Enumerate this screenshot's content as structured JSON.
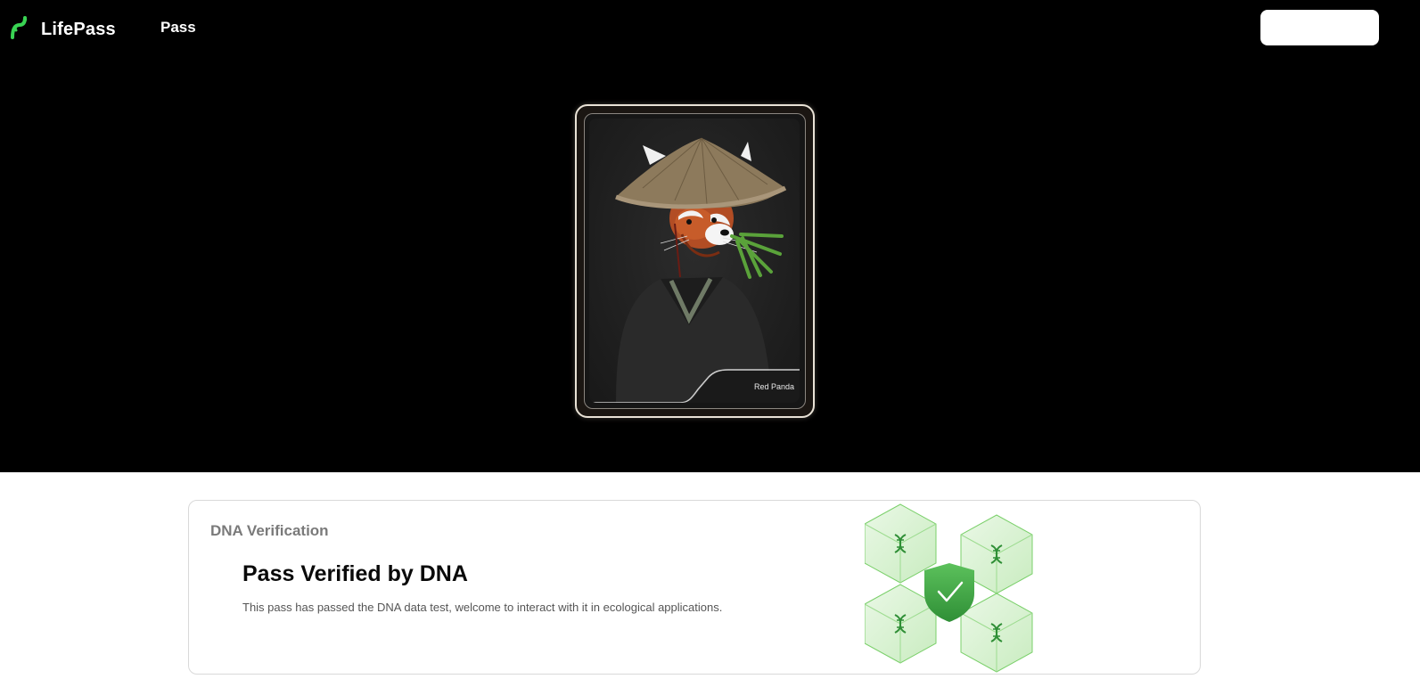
{
  "nav": {
    "brand": "LifePass",
    "links": [
      "Pass"
    ],
    "button_label": ""
  },
  "card": {
    "name": "Red Panda"
  },
  "verification": {
    "section_label": "DNA Verification",
    "title": "Pass Verified by DNA",
    "description": "This pass has passed the DNA data test, welcome to interact with it in ecological applications."
  },
  "colors": {
    "brand_green": "#39d353",
    "hero_bg": "#000000",
    "shield_green": "#4caf50"
  },
  "icons": [
    "lifepass-logo-icon",
    "dna-cube-icon",
    "shield-check-icon"
  ]
}
